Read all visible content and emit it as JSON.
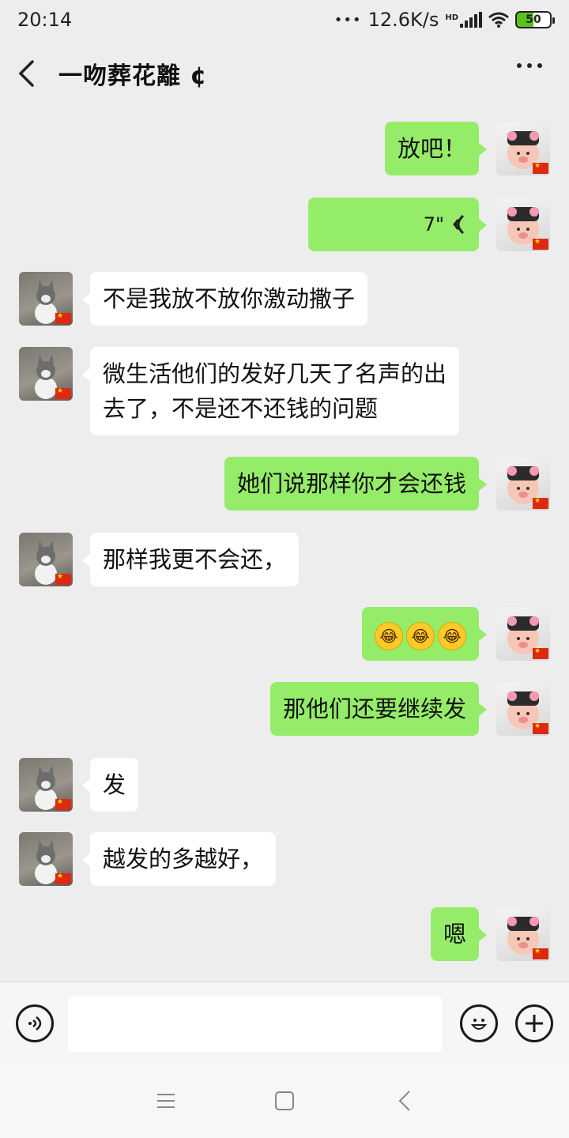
{
  "status_bar": {
    "time": "20:14",
    "network_speed": "12.6K/s",
    "hd_label": "HD",
    "battery": "50",
    "icons": [
      "more-dots-icon",
      "signal-icon",
      "wifi-icon",
      "battery-icon"
    ]
  },
  "header": {
    "title": "一吻葬花離 ¢",
    "back_icon": "chevron-left-icon",
    "more_icon": "more-dots-icon"
  },
  "messages": [
    {
      "sender": "me",
      "type": "text",
      "text": "放吧！"
    },
    {
      "sender": "me",
      "type": "voice",
      "duration": "7\""
    },
    {
      "sender": "other",
      "type": "text",
      "text": "不是我放不放你激动撒子"
    },
    {
      "sender": "other",
      "type": "text",
      "text_line1": "微生活他们的发好几天了名声的出",
      "text_line2": "去了，不是还不还钱的问题"
    },
    {
      "sender": "me",
      "type": "text",
      "text": "她们说那样你才会还钱"
    },
    {
      "sender": "other",
      "type": "text",
      "text": "那样我更不会还，"
    },
    {
      "sender": "me",
      "type": "emoji",
      "emojis": [
        "😂",
        "😂",
        "😂"
      ]
    },
    {
      "sender": "me",
      "type": "text",
      "text": "那他们还要继续发"
    },
    {
      "sender": "other",
      "type": "text",
      "text": "发"
    },
    {
      "sender": "other",
      "type": "text",
      "text": "越发的多越好，"
    },
    {
      "sender": "me",
      "type": "text",
      "text": "嗯"
    }
  ],
  "input_bar": {
    "voice_icon": "voice-toggle-icon",
    "input_value": "",
    "emoji_icon": "emoji-smile-icon",
    "plus_icon": "plus-icon"
  },
  "nav_bar": {
    "icons": [
      "menu-icon",
      "home-square-icon",
      "back-triangle-icon"
    ]
  },
  "colors": {
    "my_bubble": "#95ec69",
    "other_bubble": "#ffffff",
    "background": "#ededed"
  }
}
